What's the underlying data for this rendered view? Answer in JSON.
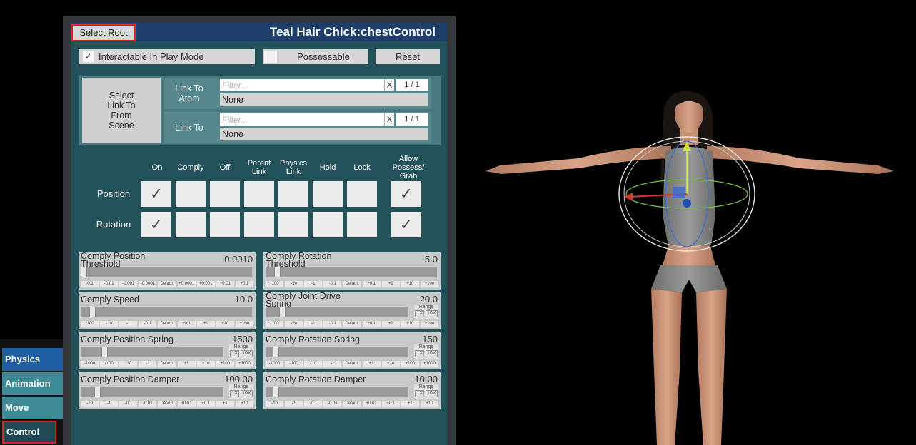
{
  "panel": {
    "select_root": "Select Root",
    "title": "Teal Hair Chick:chestControl",
    "interactable_check": "✓",
    "interactable_label": "Interactable In Play Mode",
    "possessable_label": "Possessable",
    "reset_label": "Reset"
  },
  "link": {
    "select_link_label": "Select\nLink To\nFrom\nScene",
    "rows": [
      {
        "label": "Link To\nAtom",
        "placeholder": "Filter...",
        "x": "X",
        "count": "1 / 1",
        "value": "None"
      },
      {
        "label": "Link To",
        "placeholder": "Filter...",
        "x": "X",
        "count": "1 / 1",
        "value": "None"
      }
    ]
  },
  "grid": {
    "columns": [
      "On",
      "Comply",
      "Off",
      "Parent\nLink",
      "Physics\nLink",
      "Hold",
      "Lock",
      "Allow\nPossess/\nGrab"
    ],
    "rows": [
      {
        "label": "Position",
        "on": "✓",
        "allow": "✓"
      },
      {
        "label": "Rotation",
        "on": "✓",
        "allow": "✓"
      }
    ]
  },
  "sliders": [
    {
      "label": "Comply Position\nThreshold",
      "value": "0.0010",
      "level": 0.0,
      "range": false,
      "steps": [
        "-0.1",
        "-0.01",
        "-0.001",
        "-0.0001",
        "Default",
        "+0.0001",
        "+0.001",
        "+0.01",
        "+0.1"
      ]
    },
    {
      "label": "Comply Rotation\nThreshold",
      "value": "5.0",
      "level": 0.05,
      "range": false,
      "steps": [
        "-100",
        "-10",
        "-1",
        "-0.1",
        "Default",
        "+0.1",
        "+1",
        "+10",
        "+100"
      ]
    },
    {
      "label": "Comply Speed",
      "value": "10.0",
      "level": 0.05,
      "range": false,
      "steps": [
        "-100",
        "-10",
        "-1",
        "-0.1",
        "Default",
        "+0.1",
        "+1",
        "+10",
        "+100"
      ]
    },
    {
      "label": "Comply Joint Drive\nSpring",
      "value": "20.0",
      "level": 0.1,
      "range": true,
      "steps": [
        "-100",
        "-10",
        "-1",
        "-0.1",
        "Default",
        "+0.1",
        "+1",
        "+10",
        "+100"
      ]
    },
    {
      "label": "Comply Position Spring",
      "value": "1500",
      "level": 0.15,
      "range": true,
      "steps": [
        "-1000",
        "-100",
        "-10",
        "-1",
        "Default",
        "+1",
        "+10",
        "+100",
        "+1000"
      ]
    },
    {
      "label": "Comply Rotation Spring",
      "value": "150",
      "level": 0.05,
      "range": true,
      "steps": [
        "-1000",
        "-100",
        "-10",
        "-1",
        "Default",
        "+1",
        "+10",
        "+100",
        "+1000"
      ]
    },
    {
      "label": "Comply Position Damper",
      "value": "100.00",
      "level": 0.1,
      "range": true,
      "steps": [
        "-10",
        "-1",
        "-0.1",
        "-0.01",
        "Default",
        "+0.01",
        "+0.1",
        "+1",
        "+10"
      ]
    },
    {
      "label": "Comply Rotation Damper",
      "value": "10.00",
      "level": 0.05,
      "range": true,
      "steps": [
        "-10",
        "-1",
        "-0.1",
        "-0.01",
        "Default",
        "+0.01",
        "+0.1",
        "+1",
        "+10"
      ]
    }
  ],
  "range_label": "Range",
  "range_1x": "1X",
  "range_10x": "10X",
  "tabs": [
    "Physics",
    "Animation",
    "Move",
    "Control"
  ],
  "colors": {
    "panel_teal": "#23525a",
    "header_blue": "#1f3f6b",
    "highlight_red": "#e01e1e"
  }
}
